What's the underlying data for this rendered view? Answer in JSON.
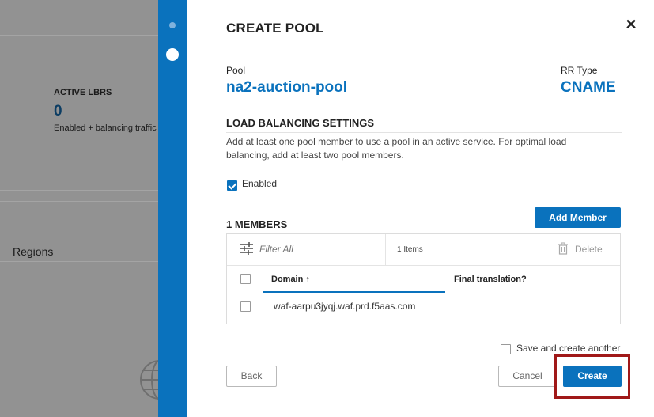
{
  "background": {
    "active_lbrs": {
      "title": "ACTIVE LBRS",
      "count": "0",
      "description": "Enabled + balancing traffic"
    },
    "regions_label": "Regions"
  },
  "modal": {
    "title": "CREATE POOL",
    "pool": {
      "label": "Pool",
      "value": "na2-auction-pool"
    },
    "rr_type": {
      "label": "RR Type",
      "value": "CNAME"
    },
    "load_balancing": {
      "title": "LOAD BALANCING SETTINGS",
      "description": "Add at least one pool member to use a pool in an active service. For optimal load balancing, add at least two pool members.",
      "enabled_label": "Enabled",
      "enabled_checked": true
    },
    "members": {
      "title": "1 MEMBERS",
      "add_button": "Add Member",
      "filter_placeholder": "Filter All",
      "items_count": "1 Items",
      "delete_label": "Delete",
      "columns": [
        "Domain ↑",
        "Final translation?"
      ],
      "rows": [
        {
          "domain": "waf-aarpu3jyqj.waf.prd.f5aas.com",
          "final_translation": ""
        }
      ]
    },
    "footer": {
      "save_another_label": "Save and create another",
      "back": "Back",
      "cancel": "Cancel",
      "create": "Create"
    }
  },
  "colors": {
    "accent": "#0a72bd",
    "highlight": "#a01818",
    "overlay": "#929292"
  }
}
